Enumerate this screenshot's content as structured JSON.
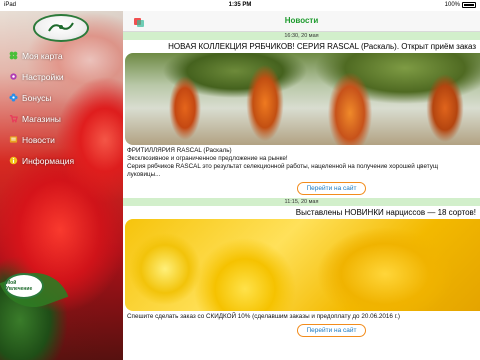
{
  "status": {
    "carrier": "iPad",
    "time": "1:35 PM",
    "battery": "100%"
  },
  "logo": {
    "text": "Мой Увлечение"
  },
  "sidebar": {
    "items": [
      {
        "label": "Моя карта",
        "icon": "clover-icon",
        "color": "#4bbf3b"
      },
      {
        "label": "Настройки",
        "icon": "gear-icon",
        "color": "#b03cb2"
      },
      {
        "label": "Бонусы",
        "icon": "flower-icon",
        "color": "#2b8ee8"
      },
      {
        "label": "Магазины",
        "icon": "cart-icon",
        "color": "#e83a5b"
      },
      {
        "label": "Новости",
        "icon": "news-icon",
        "color": "#e8a321"
      },
      {
        "label": "Информация",
        "icon": "info-icon",
        "color": "#f2c21a"
      }
    ]
  },
  "nav": {
    "title": "Новости",
    "menu_icon": "menu-icon"
  },
  "posts": [
    {
      "date": "16:30, 20 мая",
      "title": "НОВАЯ КОЛЛЕКЦИЯ РЯБЧИКОВ! СЕРИЯ RASCAL (Раскаль). Открыт приём заказ",
      "text_line1": "ФРИТИЛЛЯРИЯ RASCAL (Раскаль)",
      "text_line2": "Эксклюзивное и ограниченное предложение на рынке!",
      "text_line3": " Серия рябчиков RASCAL это результат селекционной работы, нацеленной на получение хорошей цветущ",
      "text_line4": "луковицы...",
      "button": "Перейти на сайт"
    },
    {
      "date": "11:15, 20 мая",
      "title": "Выставлены НОВИНКИ нарциссов — 18 сортов!",
      "text_line1": "Спешите сделать заказ со СКИДКОЙ 10% (сделавшим заказы и предоплату до 20.06.2016 г.)",
      "button": "Перейти на сайт"
    }
  ]
}
